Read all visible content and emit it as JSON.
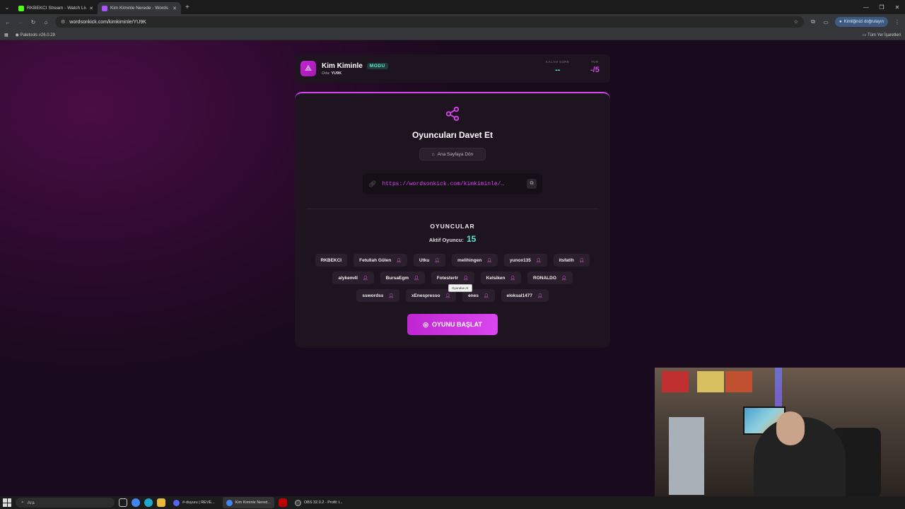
{
  "browser": {
    "tabs": [
      {
        "label": "RKBEKCI Stream - Watch Live o",
        "favicon_color": "#53fc18",
        "active": false
      },
      {
        "label": "Kim Kiminle Nerede - Words O",
        "favicon_color": "#a855f7",
        "active": true
      }
    ],
    "url": "wordsonkick.com/kimkiminle/YU9K",
    "profile_label": "Kimliğinizi doğrulayın",
    "bookmark": "Paletools v26.0.28",
    "bookmarks_right": "Tüm Yer İşaretleri"
  },
  "header": {
    "title": "Kim Kiminle",
    "mode_badge": "MODU",
    "room_label": "Oda:",
    "room_code": "YU9K",
    "time_label": "KALAN SÜRE",
    "time_value": "--",
    "round_label": "TUR",
    "round_value": "-/5"
  },
  "invite": {
    "title": "Oyuncuları Davet Et",
    "home_button": "Ana Sayfaya Dön",
    "link": "https://wordsonkick.com/kimkiminle/…"
  },
  "players_section": {
    "title": "OYUNCULAR",
    "active_label": "Aktif Oyuncu:",
    "active_count": "15",
    "players": [
      {
        "name": "RKBEKCI",
        "kick": false
      },
      {
        "name": "Fetullah Gülen",
        "kick": true
      },
      {
        "name": "Utku",
        "kick": true
      },
      {
        "name": "melihingen",
        "kick": true
      },
      {
        "name": "yunox135",
        "kick": true
      },
      {
        "name": "itsfatih",
        "kick": true
      },
      {
        "name": "alykem4l",
        "kick": true
      },
      {
        "name": "BursaEgm",
        "kick": true
      },
      {
        "name": "Fotestertr",
        "kick": true
      },
      {
        "name": "Kelsiken",
        "kick": true
      },
      {
        "name": "RONALDO",
        "kick": true
      },
      {
        "name": "sswordss",
        "kick": true
      },
      {
        "name": "xEnespresso",
        "kick": true
      },
      {
        "name": "enes",
        "kick": true
      },
      {
        "name": "eloksal1477",
        "kick": true
      }
    ],
    "tooltip": "Oyundan At"
  },
  "start_button": "OYUNU BAŞLAT",
  "taskbar": {
    "search_placeholder": "Ara",
    "apps": [
      {
        "label": "#-duyuru | REVE...",
        "color": "#5865f2",
        "active": false
      },
      {
        "label": "Kim Kiminle Nered...",
        "color": "#4285f4",
        "active": true
      },
      {
        "label": "OBS 32.0.2 - Profil: l...",
        "color": "#333333",
        "active": false
      }
    ]
  },
  "colors": {
    "accent": "#d946ef",
    "teal": "#5eead4"
  }
}
